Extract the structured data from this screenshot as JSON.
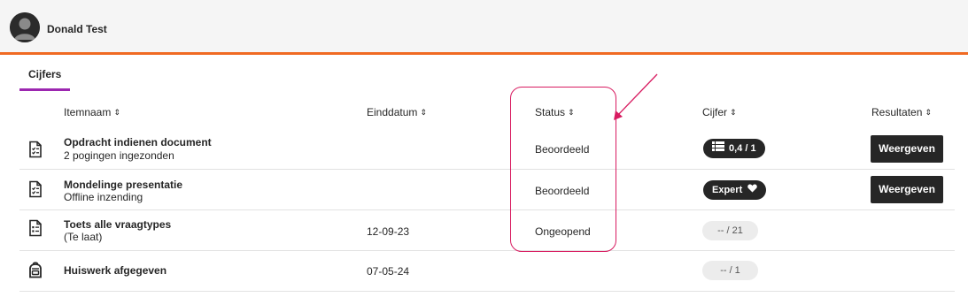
{
  "user": {
    "name": "Donald Test"
  },
  "tabs": [
    {
      "label": "Cijfers"
    }
  ],
  "columns": {
    "itemnaam": "Itemnaam",
    "einddatum": "Einddatum",
    "status": "Status",
    "cijfer": "Cijfer",
    "resultaten": "Resultaten"
  },
  "sort_glyph": "⇕",
  "rows": [
    {
      "title": "Opdracht indienen document",
      "subtitle": "2 pogingen ingezonden",
      "due": "",
      "status": "Beoordeeld",
      "grade": "0,4 / 1",
      "grade_icon": "rubric-grid-icon",
      "action": "Weergeven",
      "icon": "assignment-icon"
    },
    {
      "title": "Mondelinge presentatie",
      "subtitle": "Offline inzending",
      "due": "",
      "status": "Beoordeeld",
      "grade": "Expert",
      "grade_icon": "heart-icon",
      "action": "Weergeven",
      "icon": "assignment-icon"
    },
    {
      "title": "Toets alle vraagtypes",
      "subtitle": "(Te laat)",
      "due": "12-09-23",
      "status": "Ongeopend",
      "grade": "-- / 21",
      "action": "",
      "icon": "test-icon"
    },
    {
      "title": "Huiswerk afgegeven",
      "subtitle": "",
      "due": "07-05-24",
      "status": "",
      "grade": "-- / 1",
      "action": "",
      "icon": "backpack-icon"
    }
  ],
  "colors": {
    "header_accent": "#f06a22",
    "tab_accent": "#9c27b0",
    "annotation": "#d81b60",
    "dark_pill": "#262626"
  }
}
